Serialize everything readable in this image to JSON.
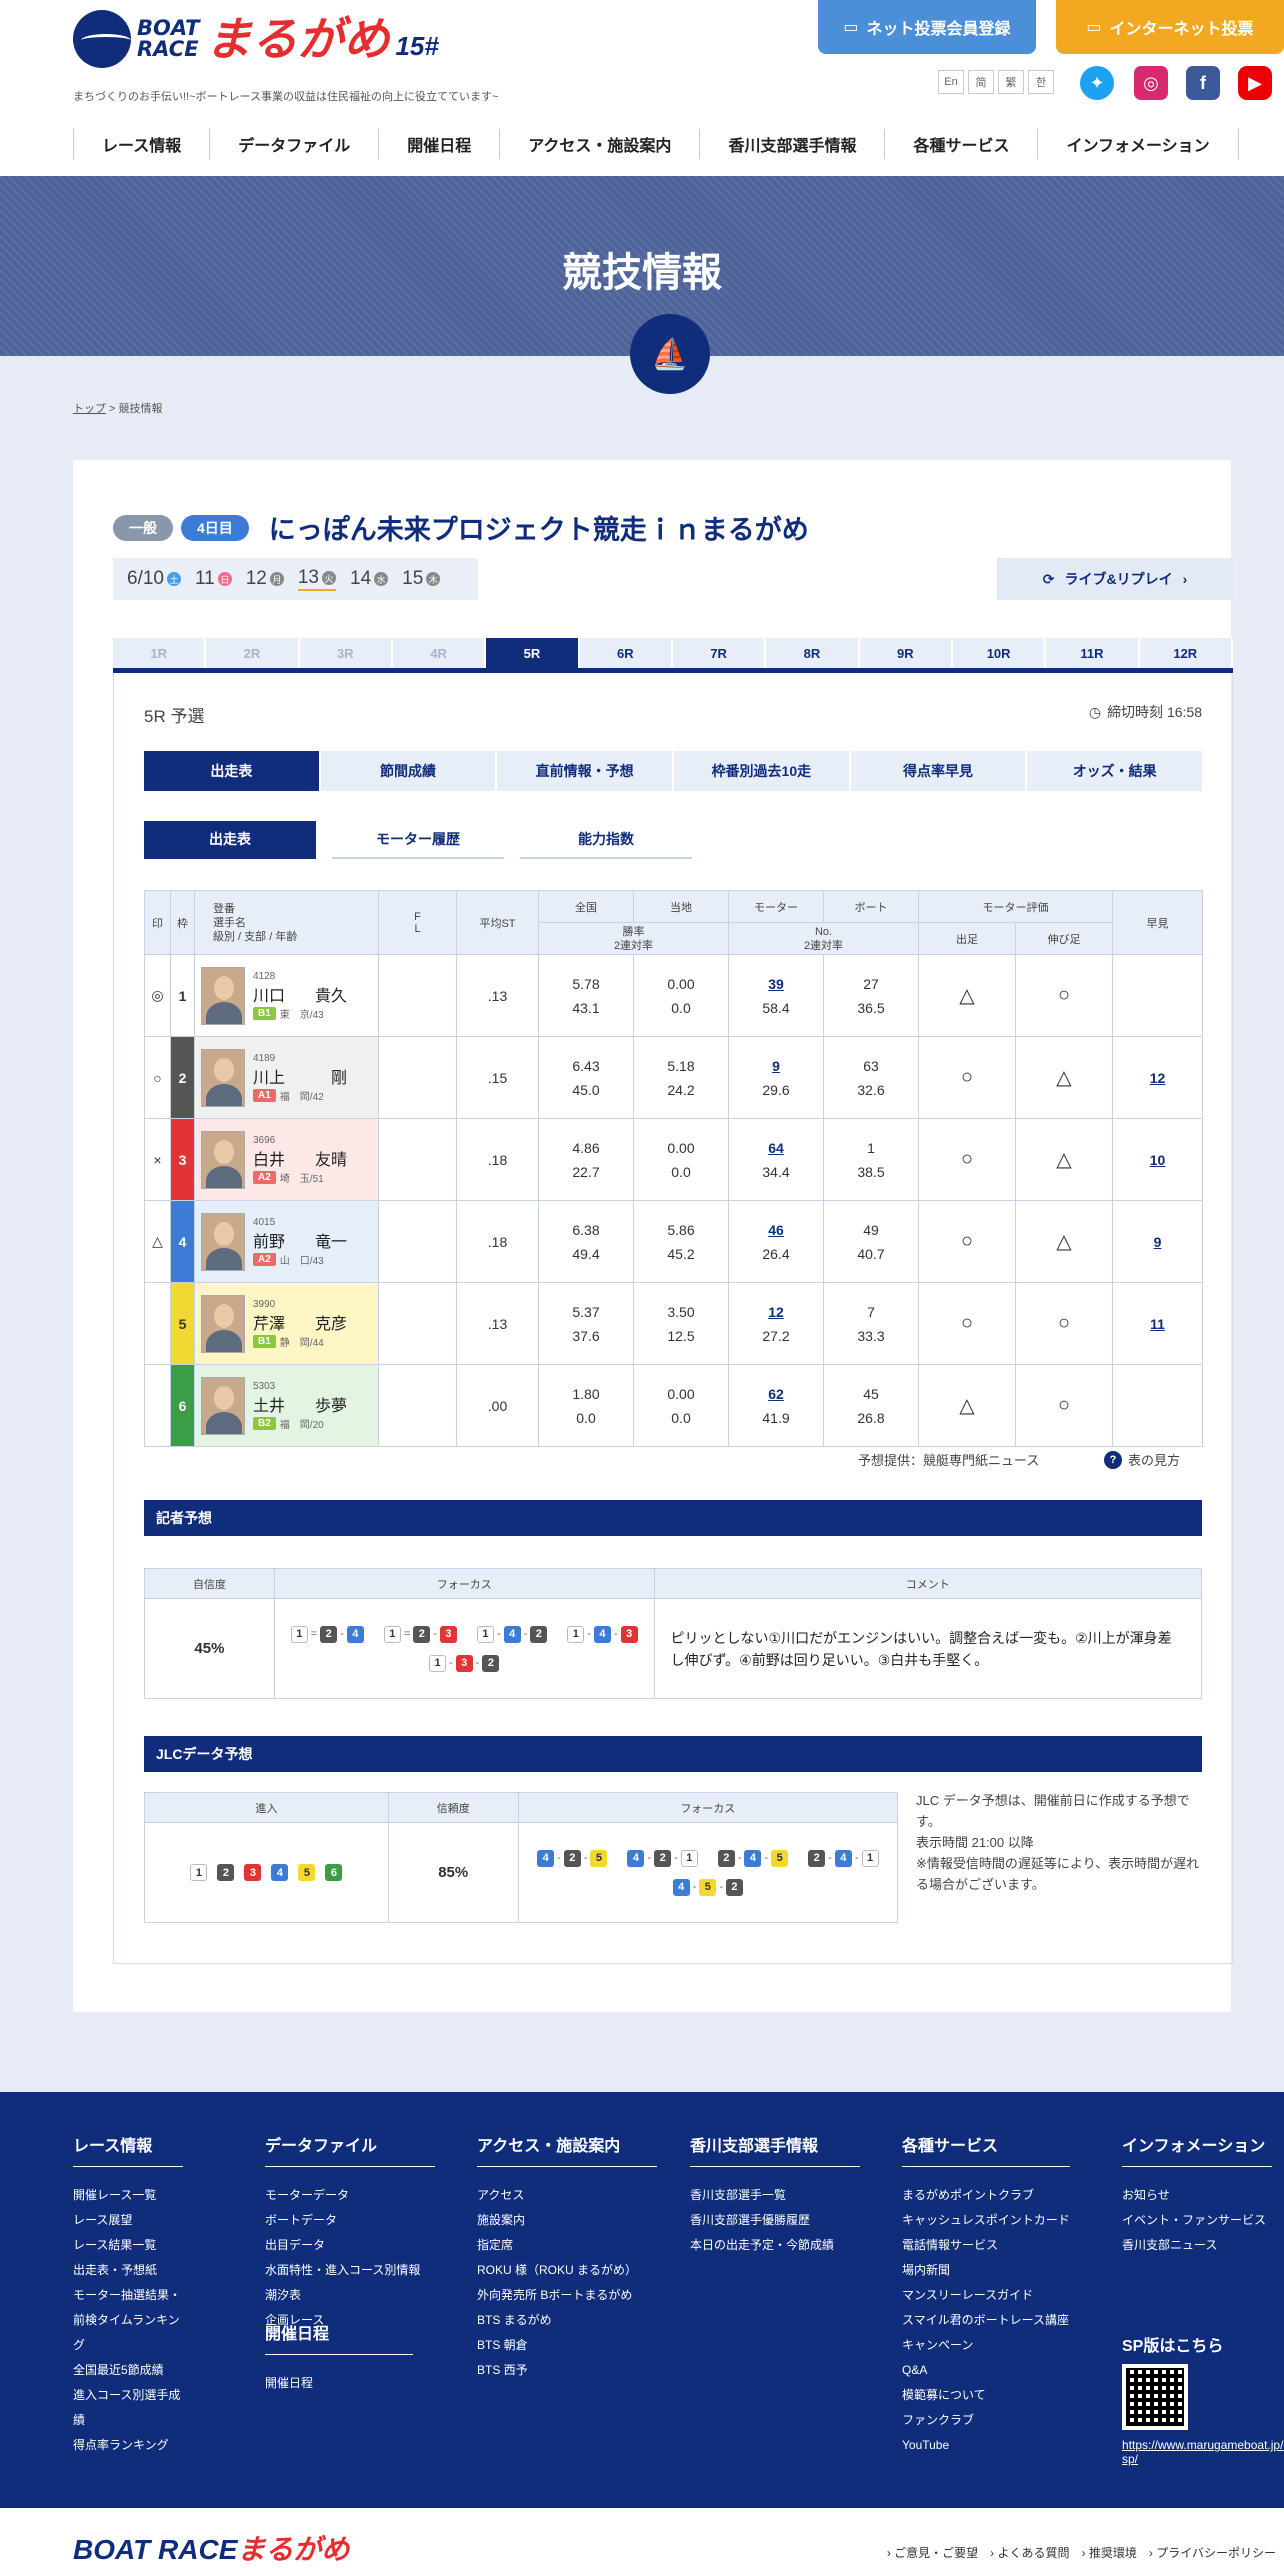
{
  "header": {
    "brand_line1": "BOAT",
    "brand_line2": "RACE",
    "brand_name": "まるがめ",
    "brand_no": "15#",
    "tagline": "まちづくりのお手伝い!!~ボートレース事業の収益は住民福祉の向上に役立てています~",
    "btn_member": "ネット投票会員登録",
    "btn_internet": "インターネット投票",
    "langs": [
      "En",
      "简",
      "繁",
      "한"
    ]
  },
  "nav": [
    "レース情報",
    "データファイル",
    "開催日程",
    "アクセス・施設案内",
    "香川支部選手情報",
    "各種サービス",
    "インフォメーション"
  ],
  "hero": {
    "title": "競技情報"
  },
  "breadcrumb": {
    "top": "トップ",
    "sep": " > ",
    "current": "競技情報"
  },
  "race": {
    "grade": "一般",
    "day_badge": "4日目",
    "title": "にっぽん未来プロジェクト競走ｉｎまるがめ",
    "days": [
      {
        "date": "6/10",
        "dot": "土",
        "color": "#4a9ee8"
      },
      {
        "date": "11",
        "dot": "日",
        "color": "#f06a8a"
      },
      {
        "date": "12",
        "dot": "月",
        "color": "#888"
      },
      {
        "date": "13",
        "dot": "火",
        "color": "#888"
      },
      {
        "date": "14",
        "dot": "水",
        "color": "#888"
      },
      {
        "date": "15",
        "dot": "木",
        "color": "#888"
      }
    ],
    "live_label": "ライブ&リプレイ",
    "races": [
      "1R",
      "2R",
      "3R",
      "4R",
      "5R",
      "6R",
      "7R",
      "8R",
      "9R",
      "10R",
      "11R",
      "12R"
    ],
    "race_name": "5R 予選",
    "deadline": "締切時刻 16:58"
  },
  "tabs": [
    "出走表",
    "節間成績",
    "直前情報・予想",
    "枠番別過去10走",
    "得点率早見",
    "オッズ・結果"
  ],
  "subtabs": [
    "出走表",
    "モーター履歴",
    "能力指数"
  ],
  "table_headers": {
    "mark": "印",
    "waku": "枠",
    "player": "登番\n選手名\n級別 / 支部 / 年齢",
    "fl": "F\nL",
    "st": "平均ST",
    "zenkoku": "全国",
    "touchi": "当地",
    "motor": "モーター",
    "boat": "ボート",
    "rate": "勝率\n2連対率",
    "no": "No.\n2連対率",
    "eval": "モーター評価",
    "deashi": "出足",
    "nobiashi": "伸び足",
    "hayami": "早見"
  },
  "entries": [
    {
      "mark": "◎",
      "waku": "1",
      "wc": "#ffffff",
      "wt": "#333",
      "bg": "#ffffff",
      "reg": "4128",
      "sei": "川口",
      "mei": "貴久",
      "cls": "B1",
      "cc": "#8dc63f",
      "branch": "東　京/43",
      "st": ".13",
      "zr": "5.78",
      "z2": "43.1",
      "tr": "0.00",
      "t2": "0.0",
      "mno": "39",
      "m2": "58.4",
      "bno": "27",
      "b2": "36.5",
      "de": "△",
      "no": "○",
      "hy": ""
    },
    {
      "mark": "○",
      "waku": "2",
      "wc": "#555555",
      "wt": "#fff",
      "bg": "#f0f0f0",
      "reg": "4189",
      "sei": "川上",
      "mei": "剛",
      "cls": "A1",
      "cc": "#ea6b6b",
      "branch": "福　岡/42",
      "st": ".15",
      "zr": "6.43",
      "z2": "45.0",
      "tr": "5.18",
      "t2": "24.2",
      "mno": "9",
      "m2": "29.6",
      "bno": "63",
      "b2": "32.6",
      "de": "○",
      "no": "△",
      "hy": "12"
    },
    {
      "mark": "×",
      "waku": "3",
      "wc": "#e23434",
      "wt": "#fff",
      "bg": "#fde8e8",
      "reg": "3696",
      "sei": "白井",
      "mei": "友晴",
      "cls": "A2",
      "cc": "#ea6b6b",
      "branch": "埼　玉/51",
      "st": ".18",
      "zr": "4.86",
      "z2": "22.7",
      "tr": "0.00",
      "t2": "0.0",
      "mno": "64",
      "m2": "34.4",
      "bno": "1",
      "b2": "38.5",
      "de": "○",
      "no": "△",
      "hy": "10"
    },
    {
      "mark": "△",
      "waku": "4",
      "wc": "#3c7bd6",
      "wt": "#fff",
      "bg": "#e6eefa",
      "reg": "4015",
      "sei": "前野",
      "mei": "竜一",
      "cls": "A2",
      "cc": "#ea6b6b",
      "branch": "山　口/43",
      "st": ".18",
      "zr": "6.38",
      "z2": "49.4",
      "tr": "5.86",
      "t2": "45.2",
      "mno": "46",
      "m2": "26.4",
      "bno": "49",
      "b2": "40.7",
      "de": "○",
      "no": "△",
      "hy": "9"
    },
    {
      "mark": "",
      "waku": "5",
      "wc": "#f4d832",
      "wt": "#333",
      "bg": "#fdf6c4",
      "reg": "3990",
      "sei": "芹澤",
      "mei": "克彦",
      "cls": "B1",
      "cc": "#8dc63f",
      "branch": "静　岡/44",
      "st": ".13",
      "zr": "5.37",
      "z2": "37.6",
      "tr": "3.50",
      "t2": "12.5",
      "mno": "12",
      "m2": "27.2",
      "bno": "7",
      "b2": "33.3",
      "de": "○",
      "no": "○",
      "hy": "11"
    },
    {
      "mark": "",
      "waku": "6",
      "wc": "#3b9d45",
      "wt": "#fff",
      "bg": "#e4f4e2",
      "reg": "5303",
      "sei": "土井",
      "mei": "歩夢",
      "cls": "B2",
      "cc": "#8dc63f",
      "branch": "福　岡/20",
      "st": ".00",
      "zr": "1.80",
      "z2": "0.0",
      "tr": "0.00",
      "t2": "0.0",
      "mno": "62",
      "m2": "41.9",
      "bno": "45",
      "b2": "26.8",
      "de": "△",
      "no": "○",
      "hy": ""
    }
  ],
  "source_note": "予想提供：競艇専門紙ニュース",
  "howto": "表の見方",
  "reporter": {
    "title": "記者予想",
    "h_conf": "自信度",
    "h_focus": "フォーカス",
    "h_comment": "コメント",
    "confidence": "45%",
    "focus": [
      [
        "1",
        "=",
        "2",
        "-",
        "4"
      ],
      [
        "1",
        "=",
        "2",
        "-",
        "3"
      ],
      [
        "1",
        "-",
        "4",
        "-",
        "2"
      ],
      [
        "1",
        "-",
        "4",
        "-",
        "3"
      ],
      [
        "1",
        "-",
        "3",
        "-",
        "2"
      ]
    ],
    "comment": "ピリッとしない①川口だがエンジンはいい。調整合えば一変も。②川上が渾身差し伸びず。④前野は回り足いい。③白井も手堅く。"
  },
  "jlc": {
    "title": "JLCデータ予想",
    "h_entry": "進入",
    "h_conf": "信頼度",
    "h_focus": "フォーカス",
    "entry": [
      "1",
      "2",
      "3",
      "4",
      "5",
      "6"
    ],
    "confidence": "85%",
    "focus": [
      [
        "4",
        "-",
        "2",
        "-",
        "5"
      ],
      [
        "4",
        "-",
        "2",
        "-",
        "1"
      ],
      [
        "2",
        "-",
        "4",
        "-",
        "5"
      ],
      [
        "2",
        "-",
        "4",
        "-",
        "1"
      ],
      [
        "4",
        "-",
        "5",
        "-",
        "2"
      ]
    ],
    "note": "JLC データ予想は、開催前日に作成する予想です。\n表示時間 21:00 以降\n※情報受信時間の遅延等により、表示時間が遅れる場合がございます。"
  },
  "footer": {
    "cols": [
      {
        "title": "レース情報",
        "items": [
          "開催レース一覧",
          "レース展望",
          "レース結果一覧",
          "出走表・予想紙",
          "モーター抽選結果・",
          "前検タイムランキング",
          "全国最近5節成績",
          "進入コース別選手成績",
          "得点率ランキング"
        ]
      },
      {
        "title": "データファイル",
        "items": [
          "モーターデータ",
          "ボートデータ",
          "出目データ",
          "水面特性・進入コース別情報",
          "潮汐表",
          "企画レース"
        ]
      },
      {
        "title": "アクセス・施設案内",
        "items": [
          "アクセス",
          "施設案内",
          "指定席",
          "ROKU 様（ROKU まるがめ）",
          "外向発売所 Bボートまるがめ",
          "BTS まるがめ",
          "BTS 朝倉",
          "BTS 西予"
        ]
      },
      {
        "title": "香川支部選手情報",
        "items": [
          "香川支部選手一覧",
          "香川支部選手優勝履歴",
          "本日の出走予定・今節成績"
        ]
      },
      {
        "title": "各種サービス",
        "items": [
          "まるがめポイントクラブ",
          "キャッシュレスポイントカード",
          "電話情報サービス",
          "場内新聞",
          "マンスリーレースガイド",
          "スマイル君のボートレース講座",
          "キャンペーン",
          "Q&A",
          "模範募について",
          "ファンクラブ",
          "YouTube"
        ]
      },
      {
        "title": "インフォメーション",
        "items": [
          "お知らせ",
          "イベント・ファンサービス",
          "香川支部ニュース"
        ]
      }
    ],
    "schedule_title": "開催日程",
    "schedule_items": [
      "開催日程"
    ],
    "sp_title": "SP版はこちら",
    "sp_url": "https://www.marugameboat.jp/sp/"
  },
  "bottom": {
    "logo1": "BOAT RACE",
    "logo2": "まるがめ",
    "links": [
      "ご意見・ご要望",
      "よくある質問",
      "推奨環境",
      "プライバシーポリシー"
    ]
  }
}
